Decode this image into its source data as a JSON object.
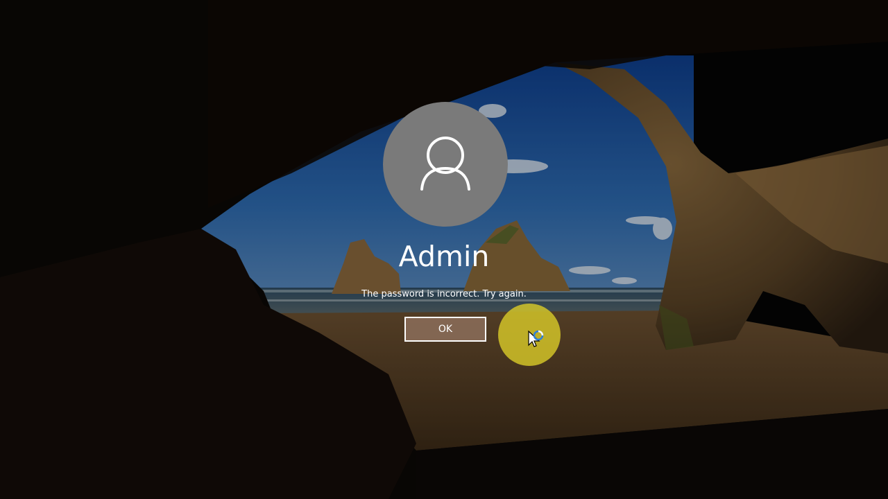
{
  "colors": {
    "avatar_bg": "#7a7a7a",
    "button_bg": "#8c6e5a",
    "highlight": "#d7c828",
    "text": "#ffffff"
  },
  "user": {
    "name": "Admin",
    "avatar_icon": "user-icon"
  },
  "message": "The password is incorrect. Try again.",
  "ok_button": {
    "label": "OK"
  },
  "cursor": {
    "icon": "busy-pointer-icon"
  }
}
